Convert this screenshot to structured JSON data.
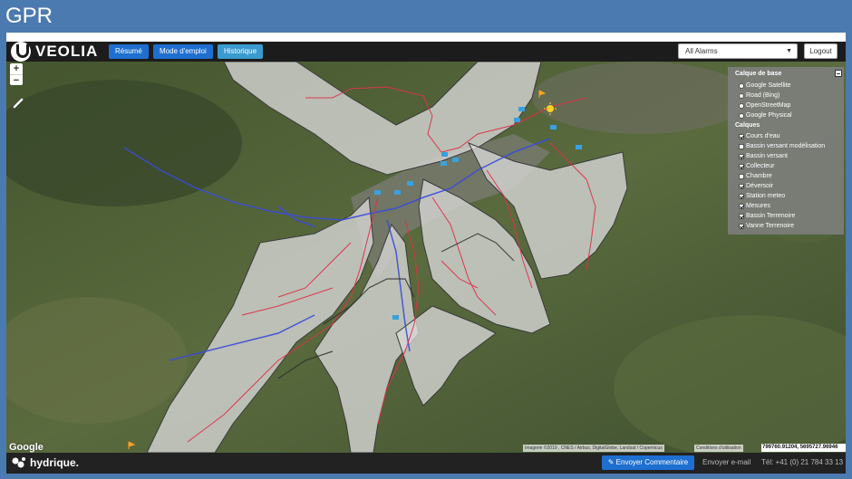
{
  "slide": {
    "title": "GPR"
  },
  "header": {
    "brand": "VEOLIA",
    "nav": [
      {
        "label": "Résumé"
      },
      {
        "label": "Mode d'emploi"
      },
      {
        "label": "Historique"
      }
    ],
    "alarm_filter": {
      "selected": "All Alarms"
    },
    "logout_label": "Logout"
  },
  "layer_panel": {
    "base_title": "Calque de base",
    "base_layers": [
      {
        "label": "Google Satellite",
        "selected": false
      },
      {
        "label": "Road (Bing)",
        "selected": false
      },
      {
        "label": "OpenStreetMap",
        "selected": false
      },
      {
        "label": "Google Physical",
        "selected": false
      }
    ],
    "overlay_title": "Calques",
    "overlays": [
      {
        "label": "Cours d'eau",
        "checked": true
      },
      {
        "label": "Bassin versant modélisation",
        "checked": false
      },
      {
        "label": "Bassin versant",
        "checked": true
      },
      {
        "label": "Collecteur",
        "checked": true
      },
      {
        "label": "Chambre",
        "checked": false
      },
      {
        "label": "Déversoir",
        "checked": true
      },
      {
        "label": "Station meteo",
        "checked": true
      },
      {
        "label": "Mesures",
        "checked": true
      },
      {
        "label": "Bassin Terrenoire",
        "checked": true
      },
      {
        "label": "Vanne Terrenoire",
        "checked": true
      }
    ]
  },
  "map": {
    "zoom_in": "+",
    "zoom_out": "−",
    "provider": "Google",
    "attribution": "Imagerie ©2019 , CNES / Airbus, DigitalGlobe, Landsat / Copernicus",
    "terms": "Conditions d'utilisation",
    "coordinates": "799760.91204, 5695727.96946"
  },
  "footer": {
    "brand": "hydrique.",
    "send_comment": "Envoyer Commentaire",
    "send_email": "Envoyer e-mail",
    "phone": "Tél: +41 (0) 21 784 33 13"
  },
  "colors": {
    "slide_bg": "#4a7ab0",
    "primary_button": "#1e6fd0",
    "secondary_button": "#3a9bd0",
    "collector": "#e0304a",
    "river": "#3a4cd8",
    "basin": "#d8d8d8"
  }
}
